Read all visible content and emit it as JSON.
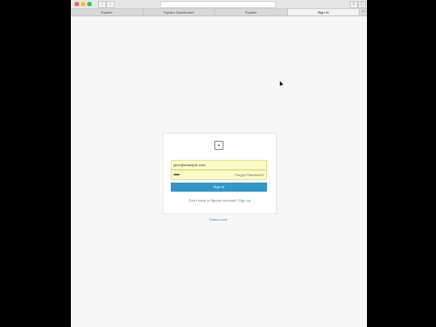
{
  "browser": {
    "url": "squareup.com",
    "nav_back": "‹",
    "nav_forward": "›",
    "share_glyph": "⇪",
    "newtab_glyph": "+",
    "tabs": [
      {
        "label": "Square"
      },
      {
        "label": "Square Dashboard"
      },
      {
        "label": "Square"
      },
      {
        "label": "Sign in"
      }
    ],
    "active_tab": 3
  },
  "login": {
    "email_value": "jane@example.com",
    "password_value": "••••••••",
    "forgot_label": "Forgot Password?",
    "signin_label": "Sign In",
    "signup_prompt": "Don't have a Square account?",
    "signup_link": "Sign up",
    "footer_link": "Status.com",
    "logo_icon": "square-logo-icon",
    "accent_color": "#3196c8",
    "autofill_color": "#fbfbc7"
  }
}
